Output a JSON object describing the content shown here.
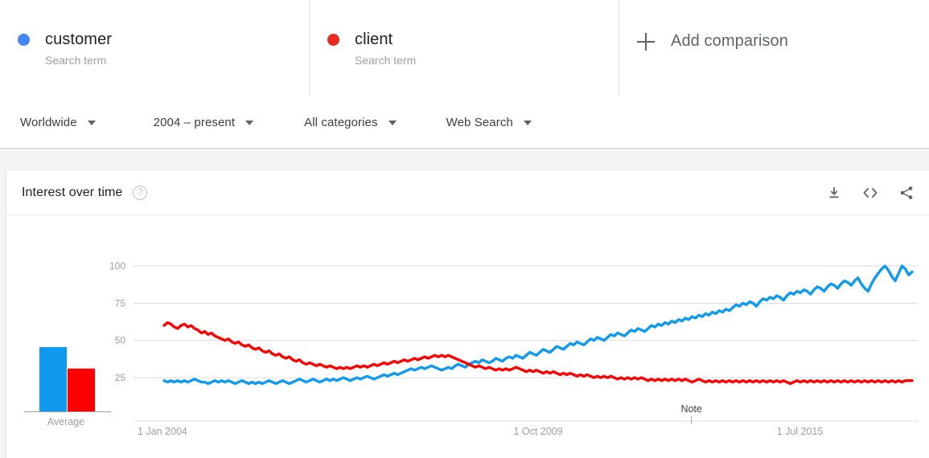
{
  "terms": [
    {
      "name": "customer",
      "subtitle": "Search term",
      "dot_color": "#4285F4",
      "dot_icon": "legend-dot-icon"
    },
    {
      "name": "client",
      "subtitle": "Search term",
      "dot_color": "#EA2B1F",
      "dot_icon": "legend-dot-icon"
    }
  ],
  "add_comparison": {
    "label": "Add comparison",
    "icon": "plus-icon"
  },
  "filters": [
    {
      "label": "Worldwide",
      "icon": "chevron-down-icon"
    },
    {
      "label": "2004 – present",
      "icon": "chevron-down-icon"
    },
    {
      "label": "All categories",
      "icon": "chevron-down-icon"
    },
    {
      "label": "Web Search",
      "icon": "chevron-down-icon"
    }
  ],
  "card": {
    "title": "Interest over time",
    "help_icon": "help-circle-icon",
    "help_glyph": "?",
    "actions": [
      {
        "name": "download-icon",
        "label": "Download"
      },
      {
        "name": "embed-icon",
        "label": "Embed"
      },
      {
        "name": "share-icon",
        "label": "Share"
      }
    ]
  },
  "average": {
    "label": "Average",
    "bars": [
      {
        "series": "customer",
        "value": 54,
        "color": "#0F9AF0"
      },
      {
        "series": "client",
        "value": 36,
        "color": "#FF0000"
      }
    ]
  },
  "chart_data": {
    "type": "line",
    "title": "Interest over time",
    "xlabel": "",
    "ylabel": "",
    "ylim": [
      0,
      100
    ],
    "yticks": [
      25,
      50,
      75,
      100
    ],
    "grid": true,
    "legend_position": "top",
    "xtick_labels": [
      "1 Jan 2004",
      "1 Oct 2009",
      "1 Jul 2015"
    ],
    "xtick_positions": [
      0.0,
      0.5,
      0.85
    ],
    "annotations": [
      {
        "text": "Note",
        "x_fraction": 0.705
      }
    ],
    "x_range": [
      "1 Jan 2004",
      "2022"
    ],
    "series": [
      {
        "name": "customer",
        "color": "#0F9AF0",
        "values": [
          23,
          22,
          23,
          22,
          23,
          22,
          23,
          22,
          23,
          24,
          23,
          22,
          22,
          21,
          22,
          23,
          22,
          23,
          22,
          23,
          22,
          21,
          22,
          23,
          22,
          21,
          22,
          21,
          22,
          21,
          22,
          23,
          22,
          21,
          22,
          23,
          22,
          21,
          22,
          23,
          24,
          23,
          22,
          23,
          24,
          23,
          22,
          23,
          24,
          23,
          24,
          23,
          24,
          25,
          24,
          23,
          24,
          25,
          24,
          25,
          26,
          25,
          24,
          25,
          26,
          27,
          26,
          27,
          28,
          27,
          28,
          29,
          30,
          31,
          30,
          31,
          32,
          31,
          32,
          33,
          32,
          31,
          30,
          31,
          32,
          31,
          33,
          34,
          33,
          32,
          34,
          35,
          36,
          35,
          37,
          36,
          35,
          36,
          38,
          37,
          36,
          38,
          39,
          38,
          40,
          39,
          38,
          40,
          42,
          41,
          40,
          42,
          44,
          43,
          42,
          44,
          46,
          45,
          44,
          46,
          48,
          47,
          49,
          48,
          47,
          49,
          51,
          50,
          52,
          51,
          50,
          52,
          54,
          53,
          55,
          54,
          53,
          55,
          57,
          56,
          58,
          57,
          56,
          58,
          60,
          59,
          61,
          60,
          62,
          61,
          63,
          62,
          64,
          63,
          65,
          64,
          66,
          65,
          67,
          66,
          68,
          67,
          69,
          68,
          70,
          69,
          71,
          70,
          72,
          74,
          73,
          75,
          74,
          76,
          75,
          73,
          76,
          78,
          77,
          79,
          78,
          80,
          79,
          77,
          80,
          82,
          81,
          83,
          82,
          84,
          83,
          81,
          84,
          86,
          85,
          83,
          86,
          88,
          87,
          85,
          88,
          90,
          89,
          87,
          90,
          92,
          88,
          85,
          83,
          88,
          92,
          95,
          98,
          100,
          97,
          93,
          90,
          95,
          100,
          98,
          94,
          96
        ]
      },
      {
        "name": "client",
        "color": "#FF0000",
        "values": [
          60,
          62,
          61,
          59,
          58,
          60,
          61,
          59,
          60,
          58,
          57,
          55,
          56,
          54,
          55,
          53,
          52,
          51,
          50,
          51,
          49,
          48,
          49,
          47,
          46,
          47,
          45,
          44,
          45,
          43,
          42,
          43,
          41,
          40,
          41,
          39,
          38,
          39,
          37,
          36,
          37,
          35,
          34,
          35,
          34,
          33,
          34,
          33,
          32,
          33,
          32,
          31,
          32,
          31,
          32,
          31,
          32,
          33,
          32,
          33,
          32,
          33,
          34,
          33,
          34,
          35,
          34,
          35,
          36,
          35,
          36,
          37,
          36,
          37,
          38,
          37,
          38,
          39,
          38,
          39,
          40,
          39,
          40,
          39,
          40,
          39,
          38,
          37,
          36,
          35,
          34,
          33,
          32,
          33,
          32,
          31,
          32,
          31,
          30,
          31,
          30,
          31,
          30,
          31,
          32,
          31,
          30,
          29,
          30,
          29,
          30,
          29,
          28,
          29,
          28,
          29,
          28,
          27,
          28,
          27,
          28,
          27,
          26,
          27,
          26,
          27,
          26,
          25,
          26,
          25,
          26,
          25,
          26,
          25,
          24,
          25,
          24,
          25,
          24,
          25,
          24,
          25,
          24,
          23,
          24,
          23,
          24,
          23,
          24,
          23,
          24,
          23,
          24,
          23,
          24,
          23,
          22,
          23,
          24,
          23,
          22,
          23,
          22,
          23,
          22,
          23,
          22,
          23,
          22,
          23,
          22,
          23,
          22,
          23,
          22,
          23,
          22,
          23,
          22,
          23,
          22,
          23,
          22,
          23,
          22,
          21,
          22,
          23,
          22,
          23,
          22,
          23,
          22,
          23,
          22,
          23,
          22,
          23,
          22,
          23,
          22,
          23,
          22,
          23,
          22,
          23,
          22,
          23,
          22,
          23,
          22,
          23,
          22,
          23,
          22,
          23,
          22,
          23,
          22,
          23,
          23,
          23
        ]
      }
    ]
  }
}
